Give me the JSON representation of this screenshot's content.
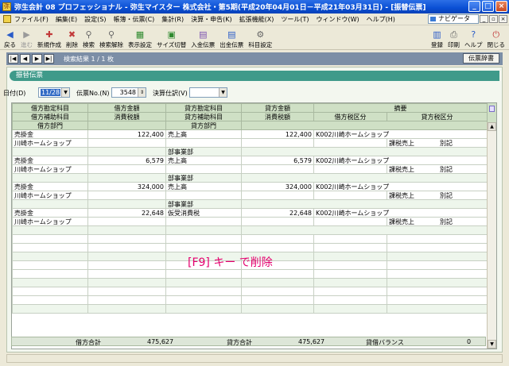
{
  "window": {
    "title": "弥生会計 08 プロフェッショナル - 弥生マイスター 株式会社・第5期(平成20年04月01日－平成21年03月31日) - [振替伝票]",
    "app_icon": "yayoi-app-icon",
    "buttons": [
      "minimize",
      "maximize",
      "close"
    ]
  },
  "menu": {
    "items": [
      "ファイル(F)",
      "編集(E)",
      "設定(S)",
      "帳簿・伝票(C)",
      "集計(R)",
      "決算・申告(K)",
      "拡張機能(X)",
      "ツール(T)",
      "ウィンドウ(W)",
      "ヘルプ(H)"
    ],
    "navi_label": "ナビゲータ"
  },
  "toolbar": {
    "left": [
      {
        "label": "戻る",
        "icon": "back-icon",
        "disabled": false
      },
      {
        "label": "進む",
        "icon": "forward-icon",
        "disabled": true
      },
      {
        "label": "新規作成",
        "icon": "new-icon",
        "disabled": false
      },
      {
        "label": "削除",
        "icon": "delete-icon",
        "disabled": false
      },
      {
        "label": "検索",
        "icon": "search-icon",
        "disabled": false
      },
      {
        "label": "検索解除",
        "icon": "search-clear-icon",
        "disabled": false
      },
      {
        "label": "表示設定",
        "icon": "display-settings-icon",
        "disabled": false
      },
      {
        "label": "サイズ切替",
        "icon": "size-toggle-icon",
        "disabled": false
      },
      {
        "label": "入金伝票",
        "icon": "receipt-slip-icon",
        "disabled": false
      },
      {
        "label": "出金伝票",
        "icon": "payment-slip-icon",
        "disabled": false
      },
      {
        "label": "科目設定",
        "icon": "account-settings-icon",
        "disabled": false
      }
    ],
    "right": [
      {
        "label": "登録",
        "icon": "register-icon"
      },
      {
        "label": "印刷",
        "icon": "print-icon"
      },
      {
        "label": "ヘルプ",
        "icon": "help-icon"
      },
      {
        "label": "閉じる",
        "icon": "close-doc-icon"
      }
    ]
  },
  "navigation": {
    "buttons": [
      "first",
      "prev",
      "next",
      "last"
    ],
    "result_text": "検索結果 1 / 1 枚",
    "dict_button": "伝票辞書"
  },
  "panel": {
    "title": "振替伝票"
  },
  "form": {
    "date_label": "日付(D)",
    "date_value": "11/28",
    "slip_no_label": "伝票No.(N)",
    "slip_no_value": "3548",
    "settlement_label": "決算仕訳(V)",
    "settlement_value": ""
  },
  "table": {
    "header_row1": [
      "借方勘定科目",
      "借方金額",
      "貸方勘定科目",
      "貸方金額",
      "摘要"
    ],
    "header_row2": [
      "借方補助科目",
      "消費税額",
      "貸方補助科目",
      "消費税額",
      "借方税区分",
      "貸方税区分"
    ],
    "header_row3": [
      "借方部門",
      "",
      "貸方部門",
      ""
    ],
    "entries": [
      {
        "debit_account": "売掛金",
        "debit_amount": "122,400",
        "credit_account": "売上高",
        "credit_amount": "122,400",
        "memo": "K002川崎ホームショップ",
        "debit_sub": "川崎ホームショップ",
        "debit_tax": "",
        "credit_sub": "",
        "credit_tax": "",
        "debit_tax_class": "",
        "credit_tax_class": "課税売上",
        "credit_tax_extra": "別記",
        "debit_dept": "",
        "credit_dept": "部事業部"
      },
      {
        "debit_account": "売掛金",
        "debit_amount": "6,579",
        "credit_account": "売上高",
        "credit_amount": "6,579",
        "memo": "K002川崎ホームショップ",
        "debit_sub": "川崎ホームショップ",
        "debit_tax": "",
        "credit_sub": "",
        "credit_tax": "",
        "debit_tax_class": "",
        "credit_tax_class": "課税売上",
        "credit_tax_extra": "別記",
        "debit_dept": "",
        "credit_dept": "部事業部"
      },
      {
        "debit_account": "売掛金",
        "debit_amount": "324,000",
        "credit_account": "売上高",
        "credit_amount": "324,000",
        "memo": "K002川崎ホームショップ",
        "debit_sub": "川崎ホームショップ",
        "debit_tax": "",
        "credit_sub": "",
        "credit_tax": "",
        "debit_tax_class": "",
        "credit_tax_class": "課税売上",
        "credit_tax_extra": "別記",
        "debit_dept": "",
        "credit_dept": "部事業部"
      },
      {
        "debit_account": "売掛金",
        "debit_amount": "22,648",
        "credit_account": "仮受消費税",
        "credit_amount": "22,648",
        "memo": "K002川崎ホームショップ",
        "debit_sub": "川崎ホームショップ",
        "debit_tax": "",
        "credit_sub": "",
        "credit_tax": "",
        "debit_tax_class": "",
        "credit_tax_class": "課税売上",
        "credit_tax_extra": "別記",
        "debit_dept": "",
        "credit_dept": ""
      }
    ]
  },
  "annotation": "[F9] キー で削除",
  "totals": {
    "debit_label": "借方合計",
    "debit_total": "475,627",
    "credit_label": "貸方合計",
    "credit_total": "475,627",
    "balance_label": "貸借バランス",
    "balance_value": "0"
  }
}
